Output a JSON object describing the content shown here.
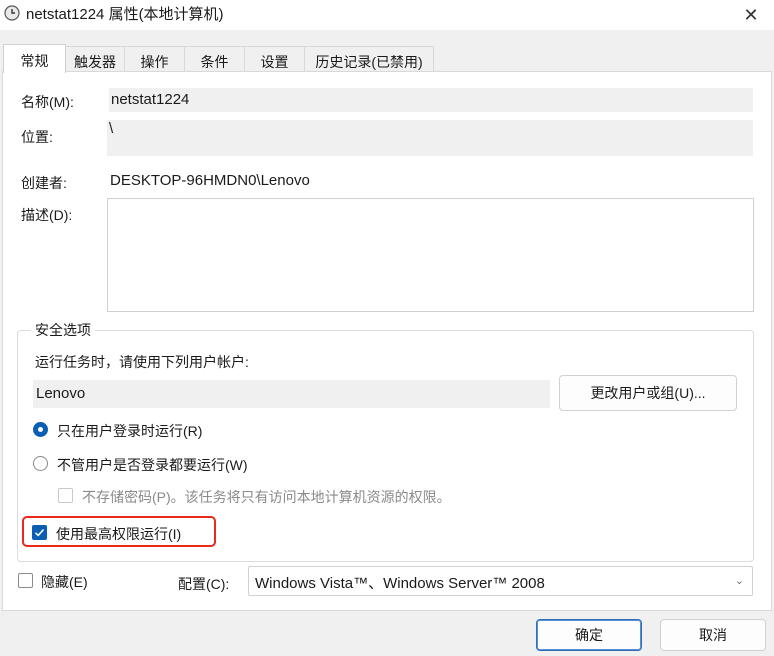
{
  "window": {
    "title": "netstat1224 属性(本地计算机)",
    "close_glyph": "✕"
  },
  "tabs": [
    {
      "label": "常规",
      "active": true
    },
    {
      "label": "触发器"
    },
    {
      "label": "操作"
    },
    {
      "label": "条件"
    },
    {
      "label": "设置"
    },
    {
      "label": "历史记录(已禁用)"
    }
  ],
  "general": {
    "name_label": "名称(M):",
    "name_value": "netstat1224",
    "location_label": "位置:",
    "location_value": "\\",
    "author_label": "创建者:",
    "author_value": "DESKTOP-96HMDN0\\Lenovo",
    "description_label": "描述(D):",
    "description_value": ""
  },
  "security": {
    "group_title": "安全选项",
    "account_prompt": "运行任务时，请使用下列用户帐户:",
    "account_value": "Lenovo",
    "change_user_button": "更改用户或组(U)...",
    "radio_logged_on": "只在用户登录时运行(R)",
    "radio_logged_on_selected": true,
    "radio_whether_logged": "不管用户是否登录都要运行(W)",
    "radio_whether_logged_selected": false,
    "do_not_store_password": "不存储密码(P)。该任务将只有访问本地计算机资源的权限。",
    "highest_privileges": "使用最高权限运行(I)",
    "highest_privileges_checked": true
  },
  "bottom": {
    "hidden_label": "隐藏(E)",
    "hidden_checked": false,
    "configure_label": "配置(C):",
    "configure_value": "Windows Vista™、Windows Server™ 2008"
  },
  "buttons": {
    "ok": "确定",
    "cancel": "取消"
  },
  "colors": {
    "accent": "#0a5fb5",
    "highlight": "#e8291c"
  }
}
